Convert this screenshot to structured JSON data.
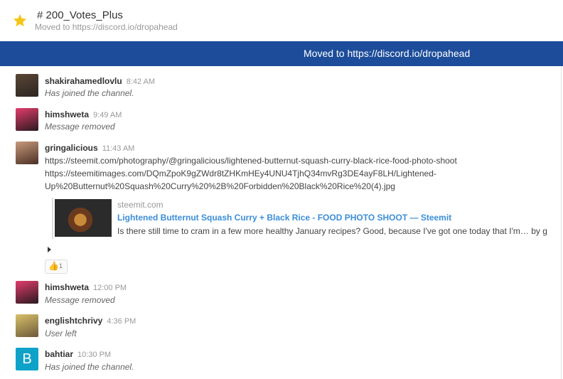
{
  "header": {
    "title": "# 200_Votes_Plus",
    "subtitle": "Moved to https://discord.io/dropahead"
  },
  "banner": {
    "text": "Moved to https://discord.io/dropahead"
  },
  "messages": [
    {
      "user": "shakirahamedlovlu",
      "time": "8:42 AM",
      "text": "Has joined the channel."
    },
    {
      "user": "himshweta",
      "time": "9:49 AM",
      "text": "Message removed"
    },
    {
      "user": "gringalicious",
      "time": "11:43 AM",
      "lines": [
        "https://steemit.com/photography/@gringalicious/lightened-butternut-squash-curry-black-rice-food-photo-shoot",
        "https://steemitimages.com/DQmZpoK9gZWdr8tZHKmHEy4UNU4TjhQ34mvRg3DE4ayF8LH/Lightened-",
        "Up%20Butternut%20Squash%20Curry%20%2B%20Forbidden%20Black%20Rice%20(4).jpg"
      ],
      "embed": {
        "site": "steemit.com",
        "title": "Lightened Butternut Squash Curry + Black Rice - FOOD PHOTO SHOOT — Steemit",
        "description": "Is there still time to cram in a few more healthy January recipes? Good, because I've got one today that I'm… by g"
      },
      "reaction": {
        "emoji": "👍",
        "count": "1"
      }
    },
    {
      "user": "himshweta",
      "time": "12:00 PM",
      "text": "Message removed"
    },
    {
      "user": "englishtchrivy",
      "time": "4:36 PM",
      "text": "User left"
    },
    {
      "user": "bahtiar",
      "time": "10:30 PM",
      "text": "Has joined the channel.",
      "avatar_letter": "B"
    }
  ],
  "colors": {
    "banner": "#1d4d9a",
    "star": "#f5c518",
    "link": "#3b8ed8",
    "letter_avatar": "#0fa2c8"
  },
  "icons": {
    "favorite": "star-icon",
    "expand": "caret-right-icon"
  }
}
